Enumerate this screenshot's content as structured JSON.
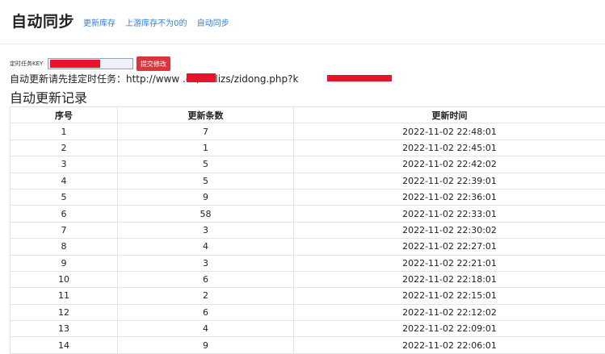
{
  "header": {
    "title": "自动同步",
    "nav": [
      "更新库存",
      "上游库存不为0的",
      "自动同步"
    ]
  },
  "key_form": {
    "label": "定时任务KEY",
    "input_value": "",
    "submit_label": "提交修改"
  },
  "hint_text": "自动更新请先挂定时任务：http://www        .cn/dailizs/zidong.php?k",
  "section_title": "自动更新记录",
  "table": {
    "headers": [
      "序号",
      "更新条数",
      "更新时间"
    ],
    "rows": [
      [
        "1",
        "7",
        "2022-11-02 22:48:01"
      ],
      [
        "2",
        "1",
        "2022-11-02 22:45:01"
      ],
      [
        "3",
        "5",
        "2022-11-02 22:42:02"
      ],
      [
        "4",
        "5",
        "2022-11-02 22:39:01"
      ],
      [
        "5",
        "9",
        "2022-11-02 22:36:01"
      ],
      [
        "6",
        "58",
        "2022-11-02 22:33:01"
      ],
      [
        "7",
        "3",
        "2022-11-02 22:30:02"
      ],
      [
        "8",
        "4",
        "2022-11-02 22:27:01"
      ],
      [
        "9",
        "3",
        "2022-11-02 22:21:01"
      ],
      [
        "10",
        "6",
        "2022-11-02 22:18:01"
      ],
      [
        "11",
        "2",
        "2022-11-02 22:15:01"
      ],
      [
        "12",
        "6",
        "2022-11-02 22:12:02"
      ],
      [
        "13",
        "4",
        "2022-11-02 22:09:01"
      ],
      [
        "14",
        "9",
        "2022-11-02 22:06:01"
      ]
    ]
  },
  "colors": {
    "accent_link": "#2f7fd8",
    "button_red": "#d9363e",
    "redaction": "#e8142c"
  }
}
